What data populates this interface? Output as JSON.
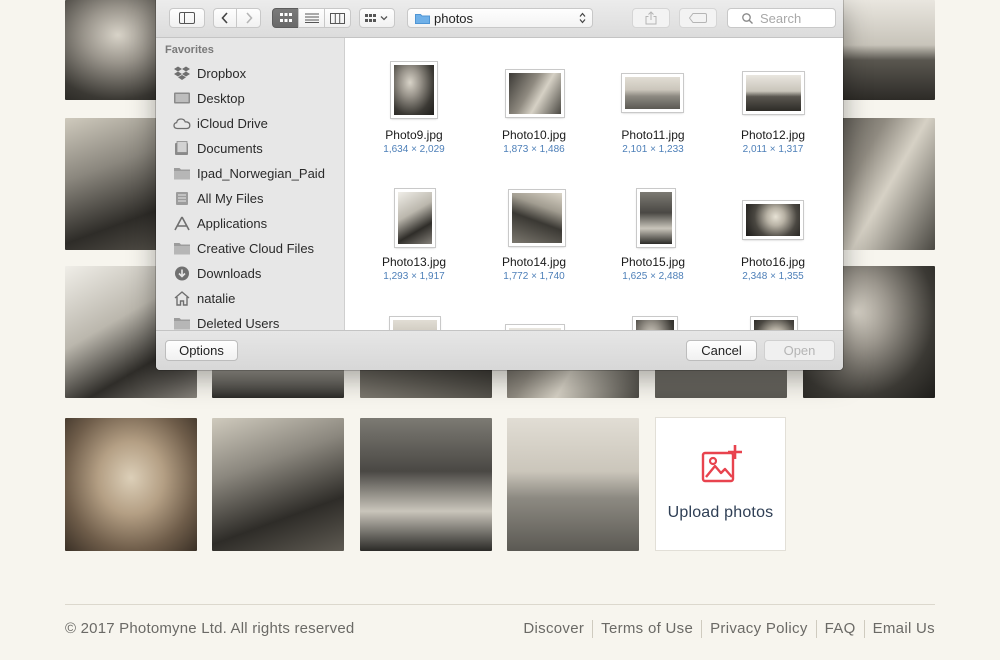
{
  "gallery": {
    "upload_label": "Upload photos",
    "accent_color": "#e8434e"
  },
  "footer": {
    "copyright": "© 2017 Photomyne Ltd. All rights reserved",
    "links": [
      "Discover",
      "Terms of Use",
      "Privacy Policy",
      "FAQ",
      "Email Us"
    ]
  },
  "dialog": {
    "toolbar": {
      "location": "photos",
      "search_placeholder": "Search"
    },
    "sidebar": {
      "header": "Favorites",
      "items": [
        {
          "label": "Dropbox",
          "icon": "dropbox-icon"
        },
        {
          "label": "Desktop",
          "icon": "desktop-icon"
        },
        {
          "label": "iCloud Drive",
          "icon": "cloud-icon"
        },
        {
          "label": "Documents",
          "icon": "document-icon"
        },
        {
          "label": "Ipad_Norwegian_Paid",
          "icon": "folder-icon"
        },
        {
          "label": "All My Files",
          "icon": "files-icon"
        },
        {
          "label": "Applications",
          "icon": "applications-icon"
        },
        {
          "label": "Creative Cloud Files",
          "icon": "folder-icon"
        },
        {
          "label": "Downloads",
          "icon": "download-icon"
        },
        {
          "label": "natalie",
          "icon": "home-icon"
        },
        {
          "label": "Deleted Users",
          "icon": "folder-icon"
        }
      ]
    },
    "files": [
      {
        "name": "Photo9.jpg",
        "dims": "1,634 × 2,029"
      },
      {
        "name": "Photo10.jpg",
        "dims": "1,873 × 1,486"
      },
      {
        "name": "Photo11.jpg",
        "dims": "2,101 × 1,233"
      },
      {
        "name": "Photo12.jpg",
        "dims": "2,011 × 1,317"
      },
      {
        "name": "Photo13.jpg",
        "dims": "1,293 × 1,917"
      },
      {
        "name": "Photo14.jpg",
        "dims": "1,772 × 1,740"
      },
      {
        "name": "Photo15.jpg",
        "dims": "1,625 × 2,488"
      },
      {
        "name": "Photo16.jpg",
        "dims": "2,348 × 1,355"
      }
    ],
    "buttons": {
      "options": "Options",
      "cancel": "Cancel",
      "open": "Open"
    }
  }
}
